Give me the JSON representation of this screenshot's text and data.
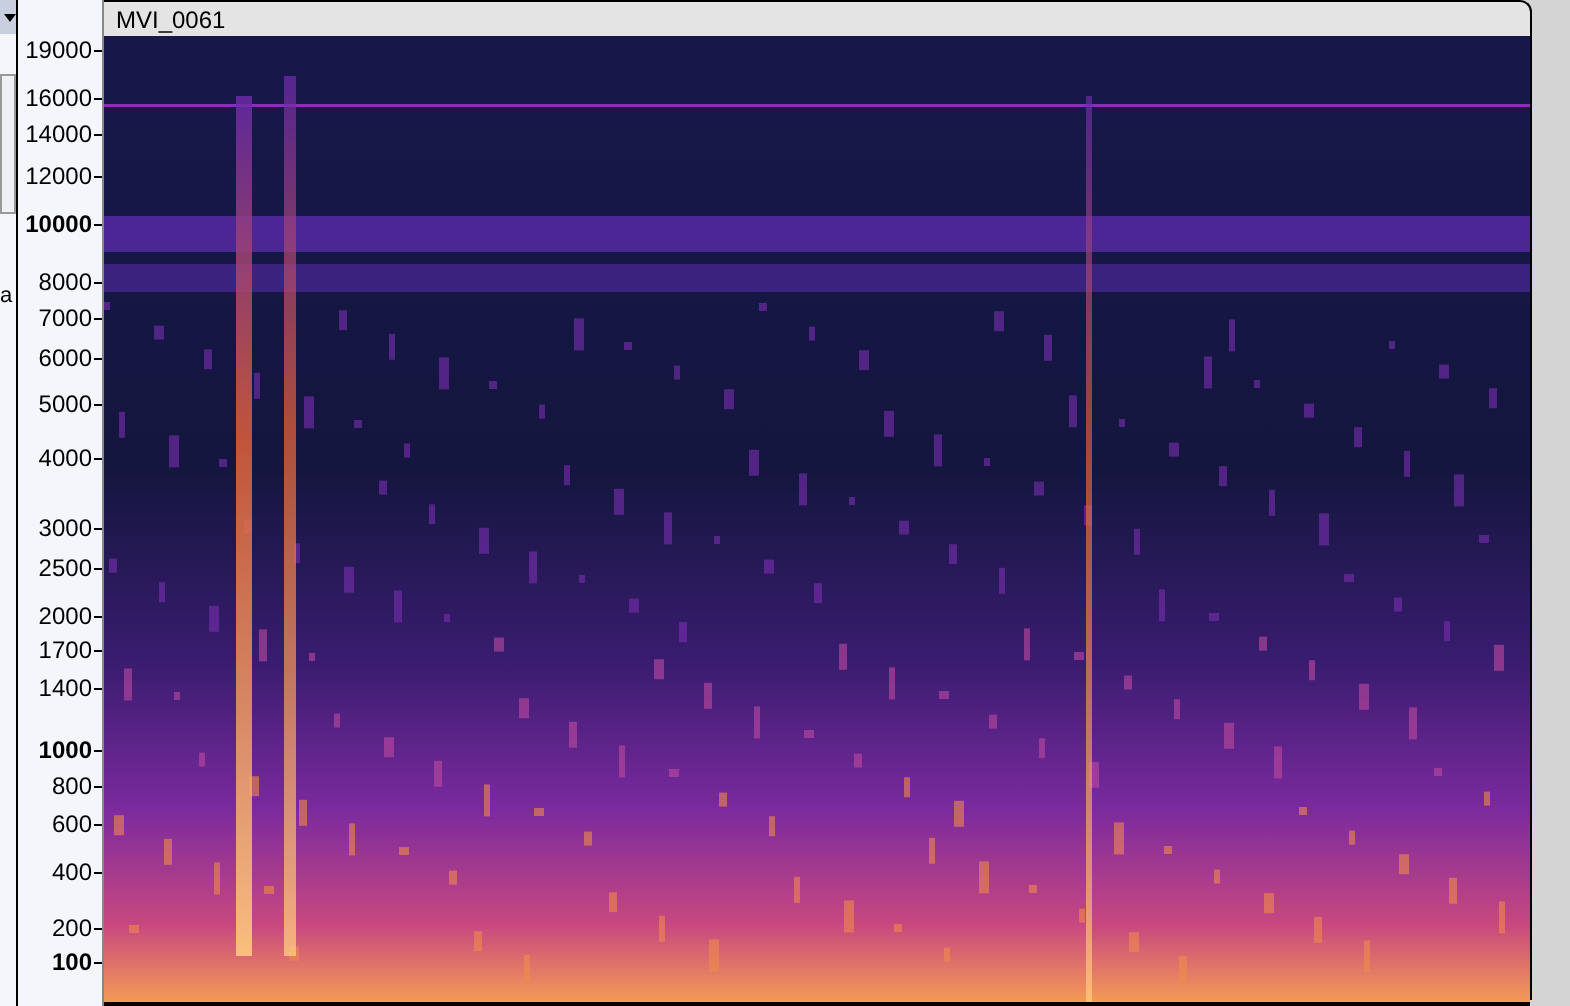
{
  "left_panel": {
    "label": "a"
  },
  "track": {
    "title": "MVI_0061"
  },
  "frequency_axis": [
    {
      "label": "19000",
      "kind": "minor"
    },
    {
      "label": "16000",
      "kind": "minor"
    },
    {
      "label": "14000",
      "kind": "minor"
    },
    {
      "label": "12000",
      "kind": "minor"
    },
    {
      "label": "10000",
      "kind": "major"
    },
    {
      "label": "8000",
      "kind": "minor"
    },
    {
      "label": "7000",
      "kind": "minor"
    },
    {
      "label": "6000",
      "kind": "minor"
    },
    {
      "label": "5000",
      "kind": "minor"
    },
    {
      "label": "4000",
      "kind": "minor"
    },
    {
      "label": "3000",
      "kind": "minor"
    },
    {
      "label": "2500",
      "kind": "minor"
    },
    {
      "label": "2000",
      "kind": "minor"
    },
    {
      "label": "1700",
      "kind": "minor"
    },
    {
      "label": "1400",
      "kind": "minor"
    },
    {
      "label": "1000",
      "kind": "major"
    },
    {
      "label": "800",
      "kind": "minor"
    },
    {
      "label": "600",
      "kind": "minor"
    },
    {
      "label": "400",
      "kind": "minor"
    },
    {
      "label": "200",
      "kind": "minor"
    },
    {
      "label": "100",
      "kind": "major"
    }
  ]
}
